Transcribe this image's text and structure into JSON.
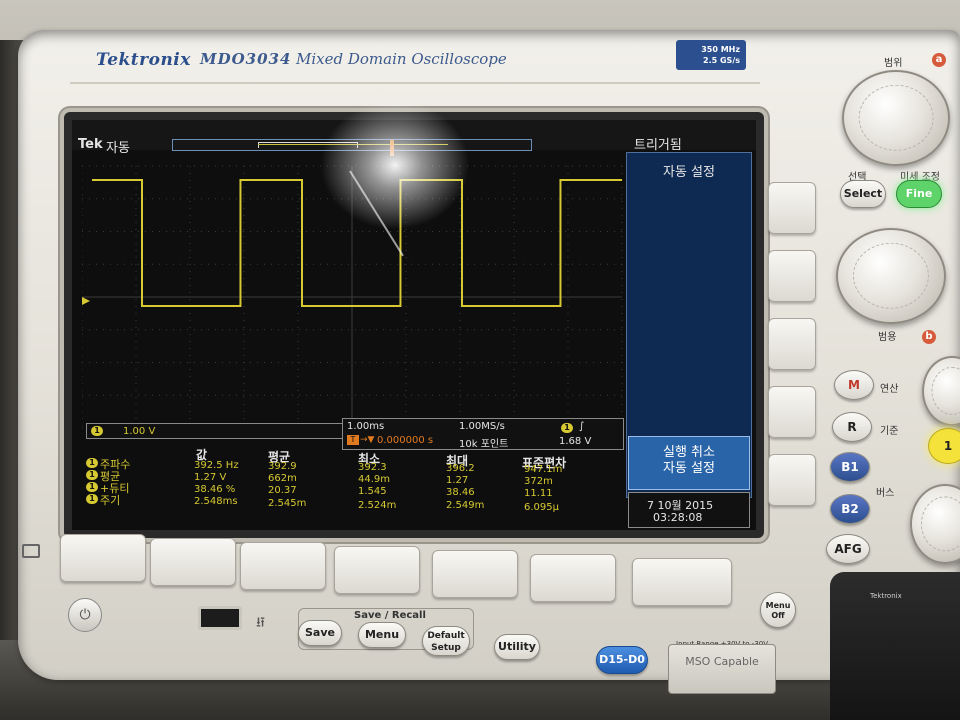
{
  "device": {
    "brand": "Tektronix",
    "model": "MDO3034",
    "subtitle": "Mixed Domain Oscilloscope",
    "spec_bandwidth": "350 MHz",
    "spec_sample_rate": "2.5 GS/s"
  },
  "status": {
    "tek": "Tek",
    "mode": "자동",
    "menu_title": "트리거됨"
  },
  "side_menu": {
    "title": "자동 설정",
    "action_line1": "실행 취소",
    "action_line2": "자동 설정"
  },
  "channel1": {
    "chip": "1",
    "scale": "1.00 V"
  },
  "timebase": {
    "time_per_div": "1.00ms",
    "sample_rate": "1.00MS/s",
    "delay": "0.000000 s",
    "record_length": "10k 포인트",
    "trigger_chip": "1",
    "trigger_slope": "∫",
    "trigger_level": "1.68 V",
    "trigger_marker": "T"
  },
  "measurements": {
    "headers": [
      "값",
      "평균",
      "최소",
      "최대",
      "표준편차"
    ],
    "rows": [
      {
        "label": "주파수",
        "values": [
          "392.5 Hz",
          "392.9",
          "392.3",
          "396.2",
          "947.1m"
        ]
      },
      {
        "label": "평균",
        "values": [
          "1.27 V",
          "662m",
          "44.9m",
          "1.27",
          "372m"
        ]
      },
      {
        "label": "+듀티",
        "values": [
          "38.46 %",
          "20.37",
          "1.545",
          "38.46",
          "11.11"
        ]
      },
      {
        "label": "주기",
        "values": [
          "2.548ms",
          "2.545m",
          "2.524m",
          "2.549m",
          "6.095μ"
        ]
      }
    ]
  },
  "clock": {
    "date": "7 10월 2015",
    "time": "03:28:08"
  },
  "waveform": {
    "color": "#d6c932",
    "duty_percent": 38.46
  },
  "panel": {
    "range_label": "범위",
    "select_label": "선택",
    "fine_tune_label": "미세 조정",
    "select_button": "Select",
    "fine_button": "Fine",
    "range_label_b": "범용",
    "badge_a": "a",
    "badge_b": "b",
    "m_button": "M",
    "m_label": "연산",
    "r_button": "R",
    "r_label": "기준",
    "b1_button": "B1",
    "b2_button": "B2",
    "bus_label": "버스",
    "afg_button": "AFG",
    "ch1_button": "1",
    "menu_off": "Menu Off",
    "save_recall_label": "Save / Recall",
    "save_button": "Save",
    "menu_button": "Menu",
    "default_setup_button": "Default Setup",
    "utility_button": "Utility",
    "d15_d0_button": "D15-D0",
    "input_range": "Input Range ±30V to -30V",
    "mso_capable": "MSO Capable",
    "usb_symbol": "⭿",
    "power_symbol": "⏻"
  }
}
